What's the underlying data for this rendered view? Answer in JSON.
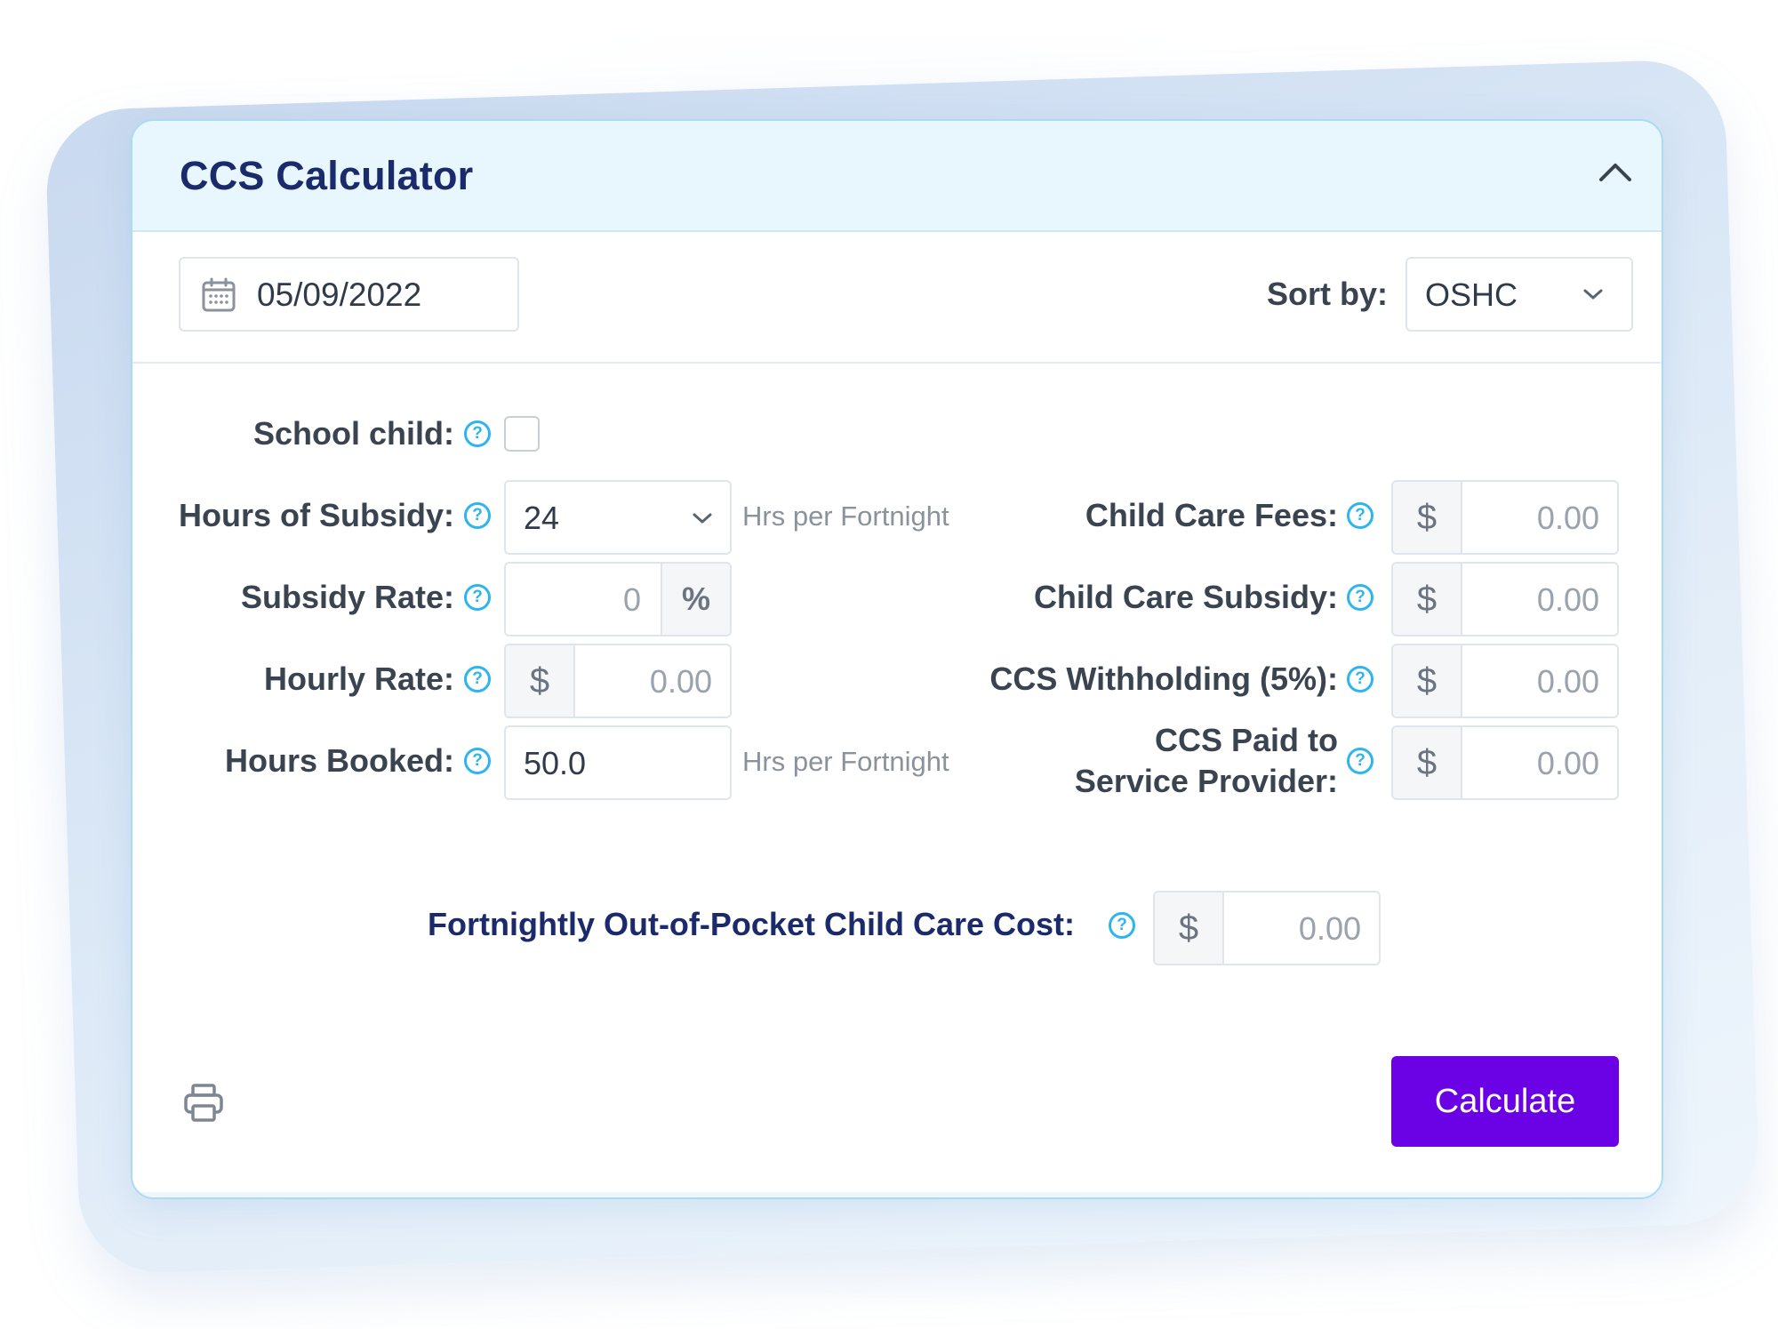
{
  "header": {
    "title": "CCS Calculator",
    "collapse_icon": "chevron-up-icon"
  },
  "toolbar": {
    "date_value": "05/09/2022",
    "date_icon": "calendar-icon",
    "sort_label": "Sort by:",
    "sort_value": "OSHC"
  },
  "left_fields": {
    "school_child": {
      "label": "School child:",
      "checked": false
    },
    "hours_of_subsidy": {
      "label": "Hours of Subsidy:",
      "value": "24",
      "unit": "Hrs per Fortnight"
    },
    "subsidy_rate": {
      "label": "Subsidy Rate:",
      "value": "0",
      "suffix": "%"
    },
    "hourly_rate": {
      "label": "Hourly Rate:",
      "prefix": "$",
      "value": "0.00"
    },
    "hours_booked": {
      "label": "Hours Booked:",
      "value": "50.0",
      "unit": "Hrs per Fortnight"
    }
  },
  "right_fields": {
    "child_care_fees": {
      "label": "Child Care Fees:",
      "prefix": "$",
      "value": "0.00"
    },
    "child_care_subsidy": {
      "label": "Child Care Subsidy:",
      "prefix": "$",
      "value": "0.00"
    },
    "ccs_withholding": {
      "label": "CCS Withholding (5%):",
      "prefix": "$",
      "value": "0.00"
    },
    "ccs_paid": {
      "label_line1": "CCS Paid to",
      "label_line2": "Service Provider:",
      "prefix": "$",
      "value": "0.00"
    }
  },
  "out_of_pocket": {
    "label": "Fortnightly Out-of-Pocket Child Care Cost:",
    "prefix": "$",
    "value": "0.00"
  },
  "help_glyph": "?",
  "actions": {
    "calculate_label": "Calculate",
    "print_icon": "printer-icon"
  },
  "colors": {
    "title": "#1b2a6b",
    "accent": "#6a02e5",
    "help": "#2db5ee",
    "header_bg": "#e8f6fd"
  }
}
